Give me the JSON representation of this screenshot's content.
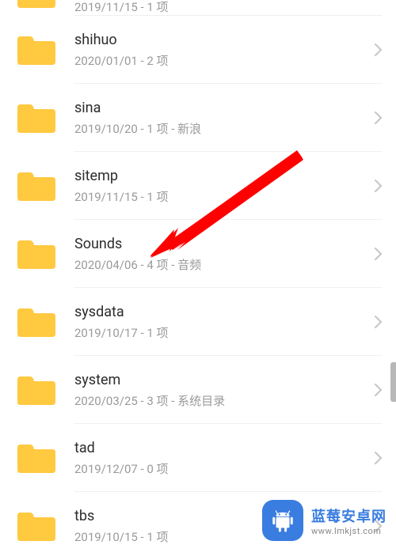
{
  "folders": [
    {
      "name": "",
      "meta": "2019/11/15 - 1 项"
    },
    {
      "name": "shihuo",
      "meta": "2020/01/01 - 2 项"
    },
    {
      "name": "sina",
      "meta": "2019/10/20 - 1 项 - 新浪"
    },
    {
      "name": "sitemp",
      "meta": "2019/11/15 - 1 项"
    },
    {
      "name": "Sounds",
      "meta": "2020/04/06 - 4 项 - 音频"
    },
    {
      "name": "sysdata",
      "meta": "2019/10/17 - 1 项"
    },
    {
      "name": "system",
      "meta": "2020/03/25 - 3 项 - 系统目录"
    },
    {
      "name": "tad",
      "meta": "2019/12/07 - 0 项"
    },
    {
      "name": "tbs",
      "meta": "2019/10/15 - 1 项"
    }
  ],
  "watermark": {
    "title": "蓝莓安卓网",
    "url": "www.lmkjst.com"
  },
  "colors": {
    "folder": "#ffc940",
    "chevron": "#c8c8c8",
    "arrow": "#ff0000",
    "brand": "#3a7de0"
  }
}
